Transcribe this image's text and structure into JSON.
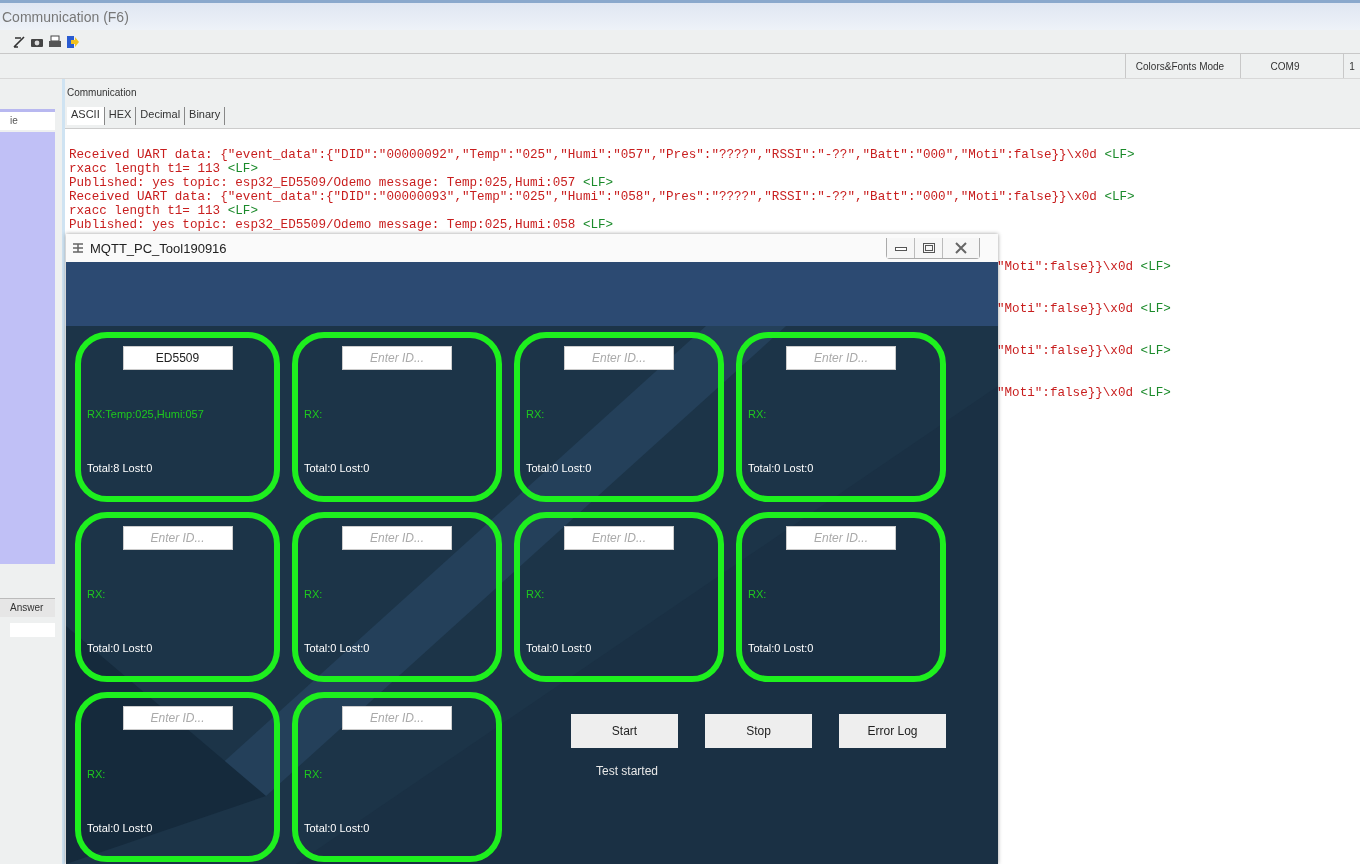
{
  "window": {
    "title": "Communication (F6)"
  },
  "status_cells": [
    "Colors&Fonts Mode",
    "COM9",
    "1"
  ],
  "sidebar": {
    "field_text": "ie",
    "answer_label": "Answer"
  },
  "panel": {
    "title": "Communication",
    "tabs": [
      {
        "label": "ASCII",
        "selected": true
      },
      {
        "label": "HEX",
        "selected": false
      },
      {
        "label": "Decimal",
        "selected": false
      },
      {
        "label": "Binary",
        "selected": false
      }
    ]
  },
  "log": [
    {
      "kind": "full",
      "text": "Received UART data: {\"event_data\":{\"DID\":\"00000092\",\"Temp\":\"025\",\"Humi\":\"057\",\"Pres\":\"????\",\"RSSI\":\"-??\",\"Batt\":\"000\",\"Moti\":false}}\\x0d",
      "end": "<LF>"
    },
    {
      "kind": "full",
      "text": "rxacc length t1= 113",
      "end": "<LF>"
    },
    {
      "kind": "full",
      "text": "Published: yes topic: esp32_ED5509/Odemo message: Temp:025,Humi:057",
      "end": "<LF>"
    },
    {
      "kind": "full",
      "text": "Received UART data: {\"event_data\":{\"DID\":\"00000093\",\"Temp\":\"025\",\"Humi\":\"058\",\"Pres\":\"????\",\"RSSI\":\"-??\",\"Batt\":\"000\",\"Moti\":false}}\\x0d",
      "end": "<LF>"
    },
    {
      "kind": "full",
      "text": "rxacc length t1= 113",
      "end": "<LF>"
    },
    {
      "kind": "full",
      "text": "Published: yes topic: esp32_ED5509/Odemo message: Temp:025,Humi:058",
      "end": "<LF>"
    },
    {
      "kind": "tail",
      "text": "\"Moti\":false}}\\x0d",
      "end": "<LF>"
    },
    {
      "kind": "tail",
      "text": "\"Moti\":false}}\\x0d",
      "end": "<LF>"
    },
    {
      "kind": "tail",
      "text": "\"Moti\":false}}\\x0d",
      "end": "<LF>"
    },
    {
      "kind": "tail",
      "text": "\"Moti\":false}}\\x0d",
      "end": "<LF>"
    }
  ],
  "mqtt_window": {
    "title": "MQTT_PC_Tool190916",
    "nodes": [
      {
        "id": "ED5509",
        "rx": "RX:Temp:025,Humi:057",
        "totals": "Total:8 Lost:0"
      },
      {
        "placeholder": "Enter ID...",
        "rx": "RX:",
        "totals": "Total:0 Lost:0"
      },
      {
        "placeholder": "Enter ID...",
        "rx": "RX:",
        "totals": "Total:0 Lost:0"
      },
      {
        "placeholder": "Enter ID...",
        "rx": "RX:",
        "totals": "Total:0 Lost:0"
      },
      {
        "placeholder": "Enter ID...",
        "rx": "RX:",
        "totals": "Total:0 Lost:0"
      },
      {
        "placeholder": "Enter ID...",
        "rx": "RX:",
        "totals": "Total:0 Lost:0"
      },
      {
        "placeholder": "Enter ID...",
        "rx": "RX:",
        "totals": "Total:0 Lost:0"
      },
      {
        "placeholder": "Enter ID...",
        "rx": "RX:",
        "totals": "Total:0 Lost:0"
      },
      {
        "placeholder": "Enter ID...",
        "rx": "RX:",
        "totals": "Total:0 Lost:0"
      },
      {
        "placeholder": "Enter ID...",
        "rx": "RX:",
        "totals": "Total:0 Lost:0"
      }
    ],
    "buttons": [
      "Start",
      "Stop",
      "Error Log"
    ],
    "status": "Test started"
  }
}
